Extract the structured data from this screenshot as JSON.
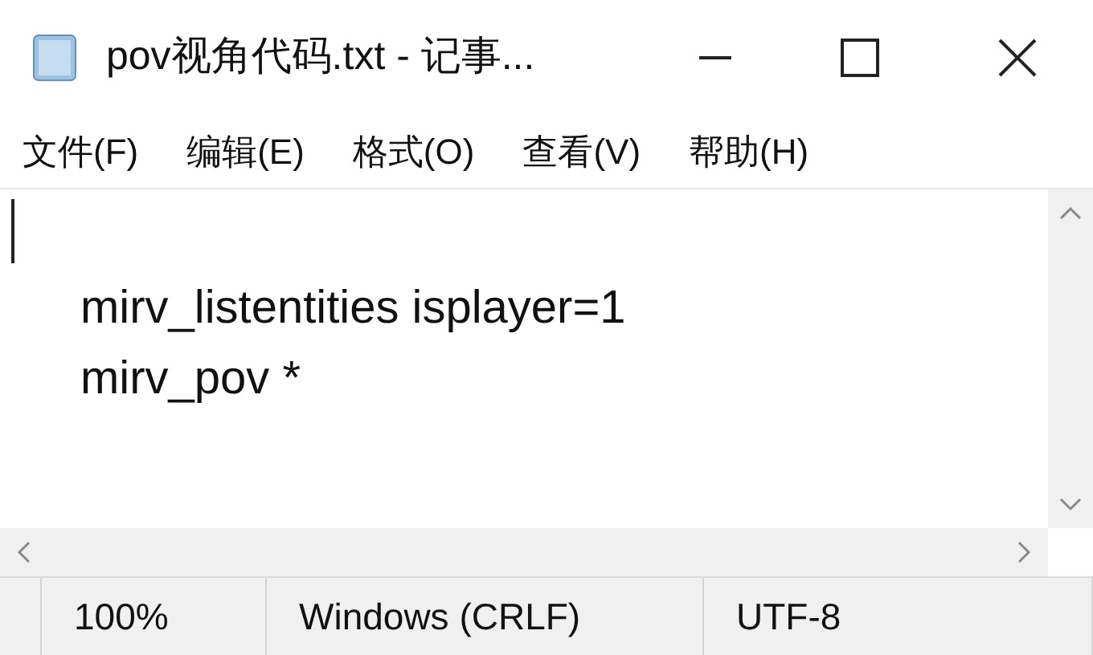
{
  "window": {
    "title": "pov视角代码.txt - 记事..."
  },
  "menu": [
    "文件(F)",
    "编辑(E)",
    "格式(O)",
    "查看(V)",
    "帮助(H)"
  ],
  "editor": {
    "lines": [
      "mirv_listentities isplayer=1",
      "mirv_pov *"
    ]
  },
  "status_bar": [
    "100%",
    "Windows (CRLF)",
    "UTF-8"
  ]
}
